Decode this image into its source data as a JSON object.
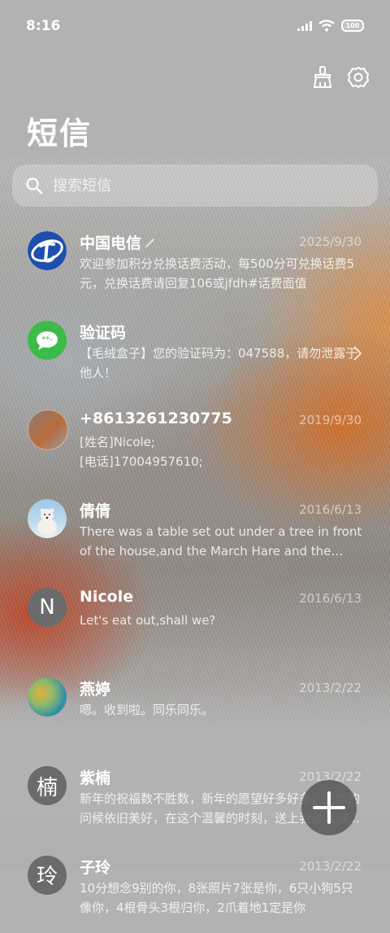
{
  "status": {
    "time": "8:16",
    "battery": "100"
  },
  "header": {
    "title": "短信"
  },
  "search": {
    "placeholder": "搜索短信"
  },
  "messages": [
    {
      "name": "中国电信",
      "date": "2025/9/30",
      "preview": "欢迎参加积分兑换话费活动，每500分可兑换话费5元，兑换话费请回复106或jfdh#话费面值"
    },
    {
      "name": "验证码",
      "date": "",
      "preview": "【毛绒盒子】您的验证码为：047588，请勿泄露于他人！"
    },
    {
      "name": "+8613261230775",
      "date": "2019/9/30",
      "preview_line1": "[姓名]Nicole;",
      "preview_line2": "[电话]17004957610;"
    },
    {
      "name": "倩倩",
      "date": "2016/6/13",
      "preview": "There was a table set out under a tree in front of the house,and the March Hare and the Hatter were having tea at it"
    },
    {
      "name": "Nicole",
      "date": "2016/6/13",
      "preview": "Let's eat out,shall we?",
      "initial": "N"
    },
    {
      "name": "燕婷",
      "date": "2013/2/22",
      "preview": "嗯。收到啦。同乐同乐。"
    },
    {
      "name": "紫楠",
      "date": "2013/2/22",
      "preview": "新年的祝福数不胜数，新年的愿望好多好多，新年的问候依旧美好，在这个温馨的时刻，送上我最真诚的祝福",
      "initial": "楠"
    },
    {
      "name": "子玲",
      "date": "2013/2/22",
      "preview": "10分想念9别的你，8张照片7张是你，6只小狗5只像你，4根骨头3根归你，2爪着地1定是你",
      "initial": "玲"
    }
  ],
  "colors": {
    "telecom_blue": "#1c4fb0",
    "chat_green": "#3dbb4a",
    "avatar_gray": "#6b6b6b"
  }
}
